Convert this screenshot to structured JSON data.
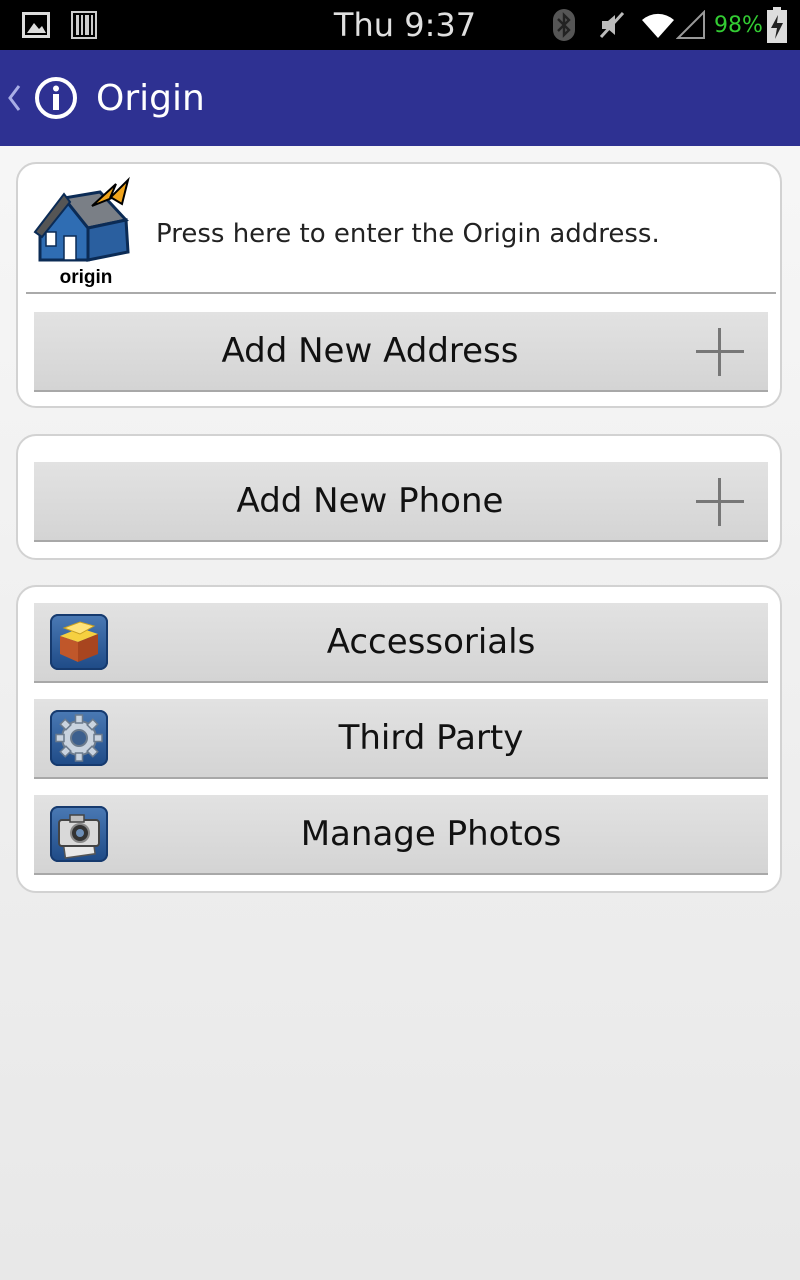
{
  "status_bar": {
    "time": "Thu 9:37",
    "battery": "98%",
    "battery_color": "#33cc33",
    "icons": [
      "image-notification-icon",
      "barcode-notification-icon",
      "bluetooth-icon",
      "mute-icon",
      "wifi-icon",
      "signal-icon",
      "battery-charging-icon"
    ]
  },
  "action_bar": {
    "title": "Origin",
    "background": "#2e3192",
    "icons": [
      "back-chevron-icon",
      "info-icon"
    ]
  },
  "address_card": {
    "origin_logo_text": "origin",
    "origin_prompt": "Press here to enter the Origin address.",
    "add_address_label": "Add New Address"
  },
  "phone_card": {
    "add_phone_label": "Add New Phone"
  },
  "actions_card": {
    "items": [
      {
        "label": "Accessorials",
        "icon": "package-icon"
      },
      {
        "label": "Third Party",
        "icon": "gear-icon"
      },
      {
        "label": "Manage Photos",
        "icon": "camera-icon"
      }
    ]
  }
}
